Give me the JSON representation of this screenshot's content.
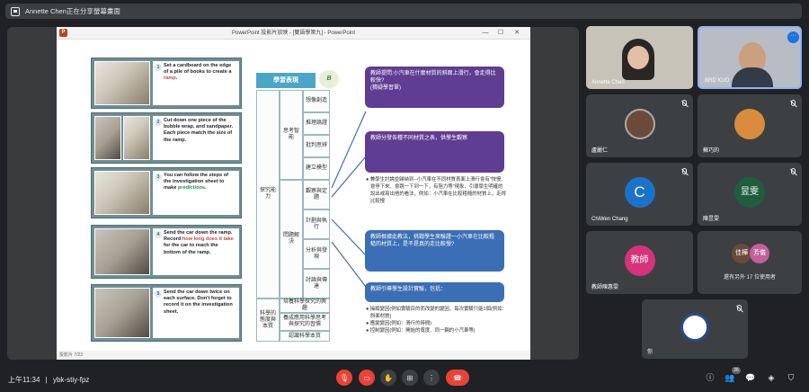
{
  "notification": "Annette Chen正在分享螢幕畫面",
  "ppt": {
    "title": "PowerPoint 投影片放映 - [雙語學第九] - PowerPoint",
    "status": "投影片 7/23"
  },
  "slide": {
    "steps": [
      {
        "num": "1",
        "pre": "Set a cardboard on the edge of a pile of books to create a ",
        "hl": "ramp",
        "post": "."
      },
      {
        "num": "2",
        "pre": "Cut down one piece of the bubble wrap, and sandpaper. Each piece match the size of the ramp.",
        "hl": "",
        "post": ""
      },
      {
        "num": "3",
        "pre": "You can follow the steps of the investigation sheet to make ",
        "hl": "predictions",
        "post": "."
      },
      {
        "num": "4",
        "pre": "Send the car down the ramp. Record ",
        "hl": "how long does it take",
        "post": " for the car to reach the bottom of the ramp."
      },
      {
        "num": "5",
        "pre": "Send the car down twice on each surface. Don't forget to record it on the investigation sheet.",
        "hl": "",
        "post": ""
      }
    ],
    "table_header": "學習表現",
    "col1": [
      "探究能力",
      "科學的態度與本質"
    ],
    "col2": [
      "思考智能",
      "問題解決"
    ],
    "col3a": [
      "想像創造",
      "推理論證",
      "批判思辨",
      "建立模型"
    ],
    "col3b": [
      "觀察與定題",
      "計劃與執行",
      "分析與發現",
      "討論與傳達"
    ],
    "col3c": [
      "培養科學探究的興趣",
      "養成應用科學思考與探究的習慣",
      "認識科學本質"
    ],
    "cards": [
      "教師提問:小汽車在什麼材質的斜面上滑行，會走得比較快?\n(猜疑學習單)",
      "教師分發各種不同材質之表，供學生觀察",
      "教師根據此教法，挑戰學生來驗證一小汽車在比較粗糙的材質上，是不是真的走比較慢?",
      "教師引導學生設計實驗，包括："
    ],
    "bullet1": "● 兼學生討論並歸納到--小汽車在不同材質表面上滑行會有\"快慢、會停下來、會跳一下到一下，有阻力等\"現象，引導學生明確的說出或寫出他的看法，例如：小汽車在比較粗糙的材質上，走得比較慢",
    "bullets2": [
      "● 操縱變因(例如實驗目的而改變的變因，每次實驗只能1個(例如：斜面材質)",
      "● 應變變因(例如：滑行的時間)",
      "● 控制變因(例如：開始的寬度、同一輛的小汽車等)"
    ]
  },
  "participants": [
    {
      "name": "Annette Chen",
      "type": "video"
    },
    {
      "name": "BRD KUO",
      "type": "video"
    },
    {
      "name": "盧麗仁",
      "type": "photo"
    },
    {
      "name": "蘇巧的",
      "type": "photo"
    },
    {
      "name": "ChiWen Chang",
      "type": "avatar",
      "initial": "C",
      "color": "#1a73c8"
    },
    {
      "name": "陳昱雯",
      "type": "avatar",
      "initial": "昱雯",
      "color": "#1e5e3e"
    },
    {
      "name": "教師陳惠雯",
      "type": "avatar",
      "initial": "教師",
      "color": "#d6337a"
    },
    {
      "name": "還有另外 17 位使用者",
      "type": "group",
      "a": "佳樺",
      "b": "芳儀"
    },
    {
      "name": "你",
      "type": "photo"
    }
  ],
  "bottom": {
    "time": "上午11:34",
    "separator": "|",
    "code": "ybk-stiy-fpz",
    "people_count": "26"
  }
}
